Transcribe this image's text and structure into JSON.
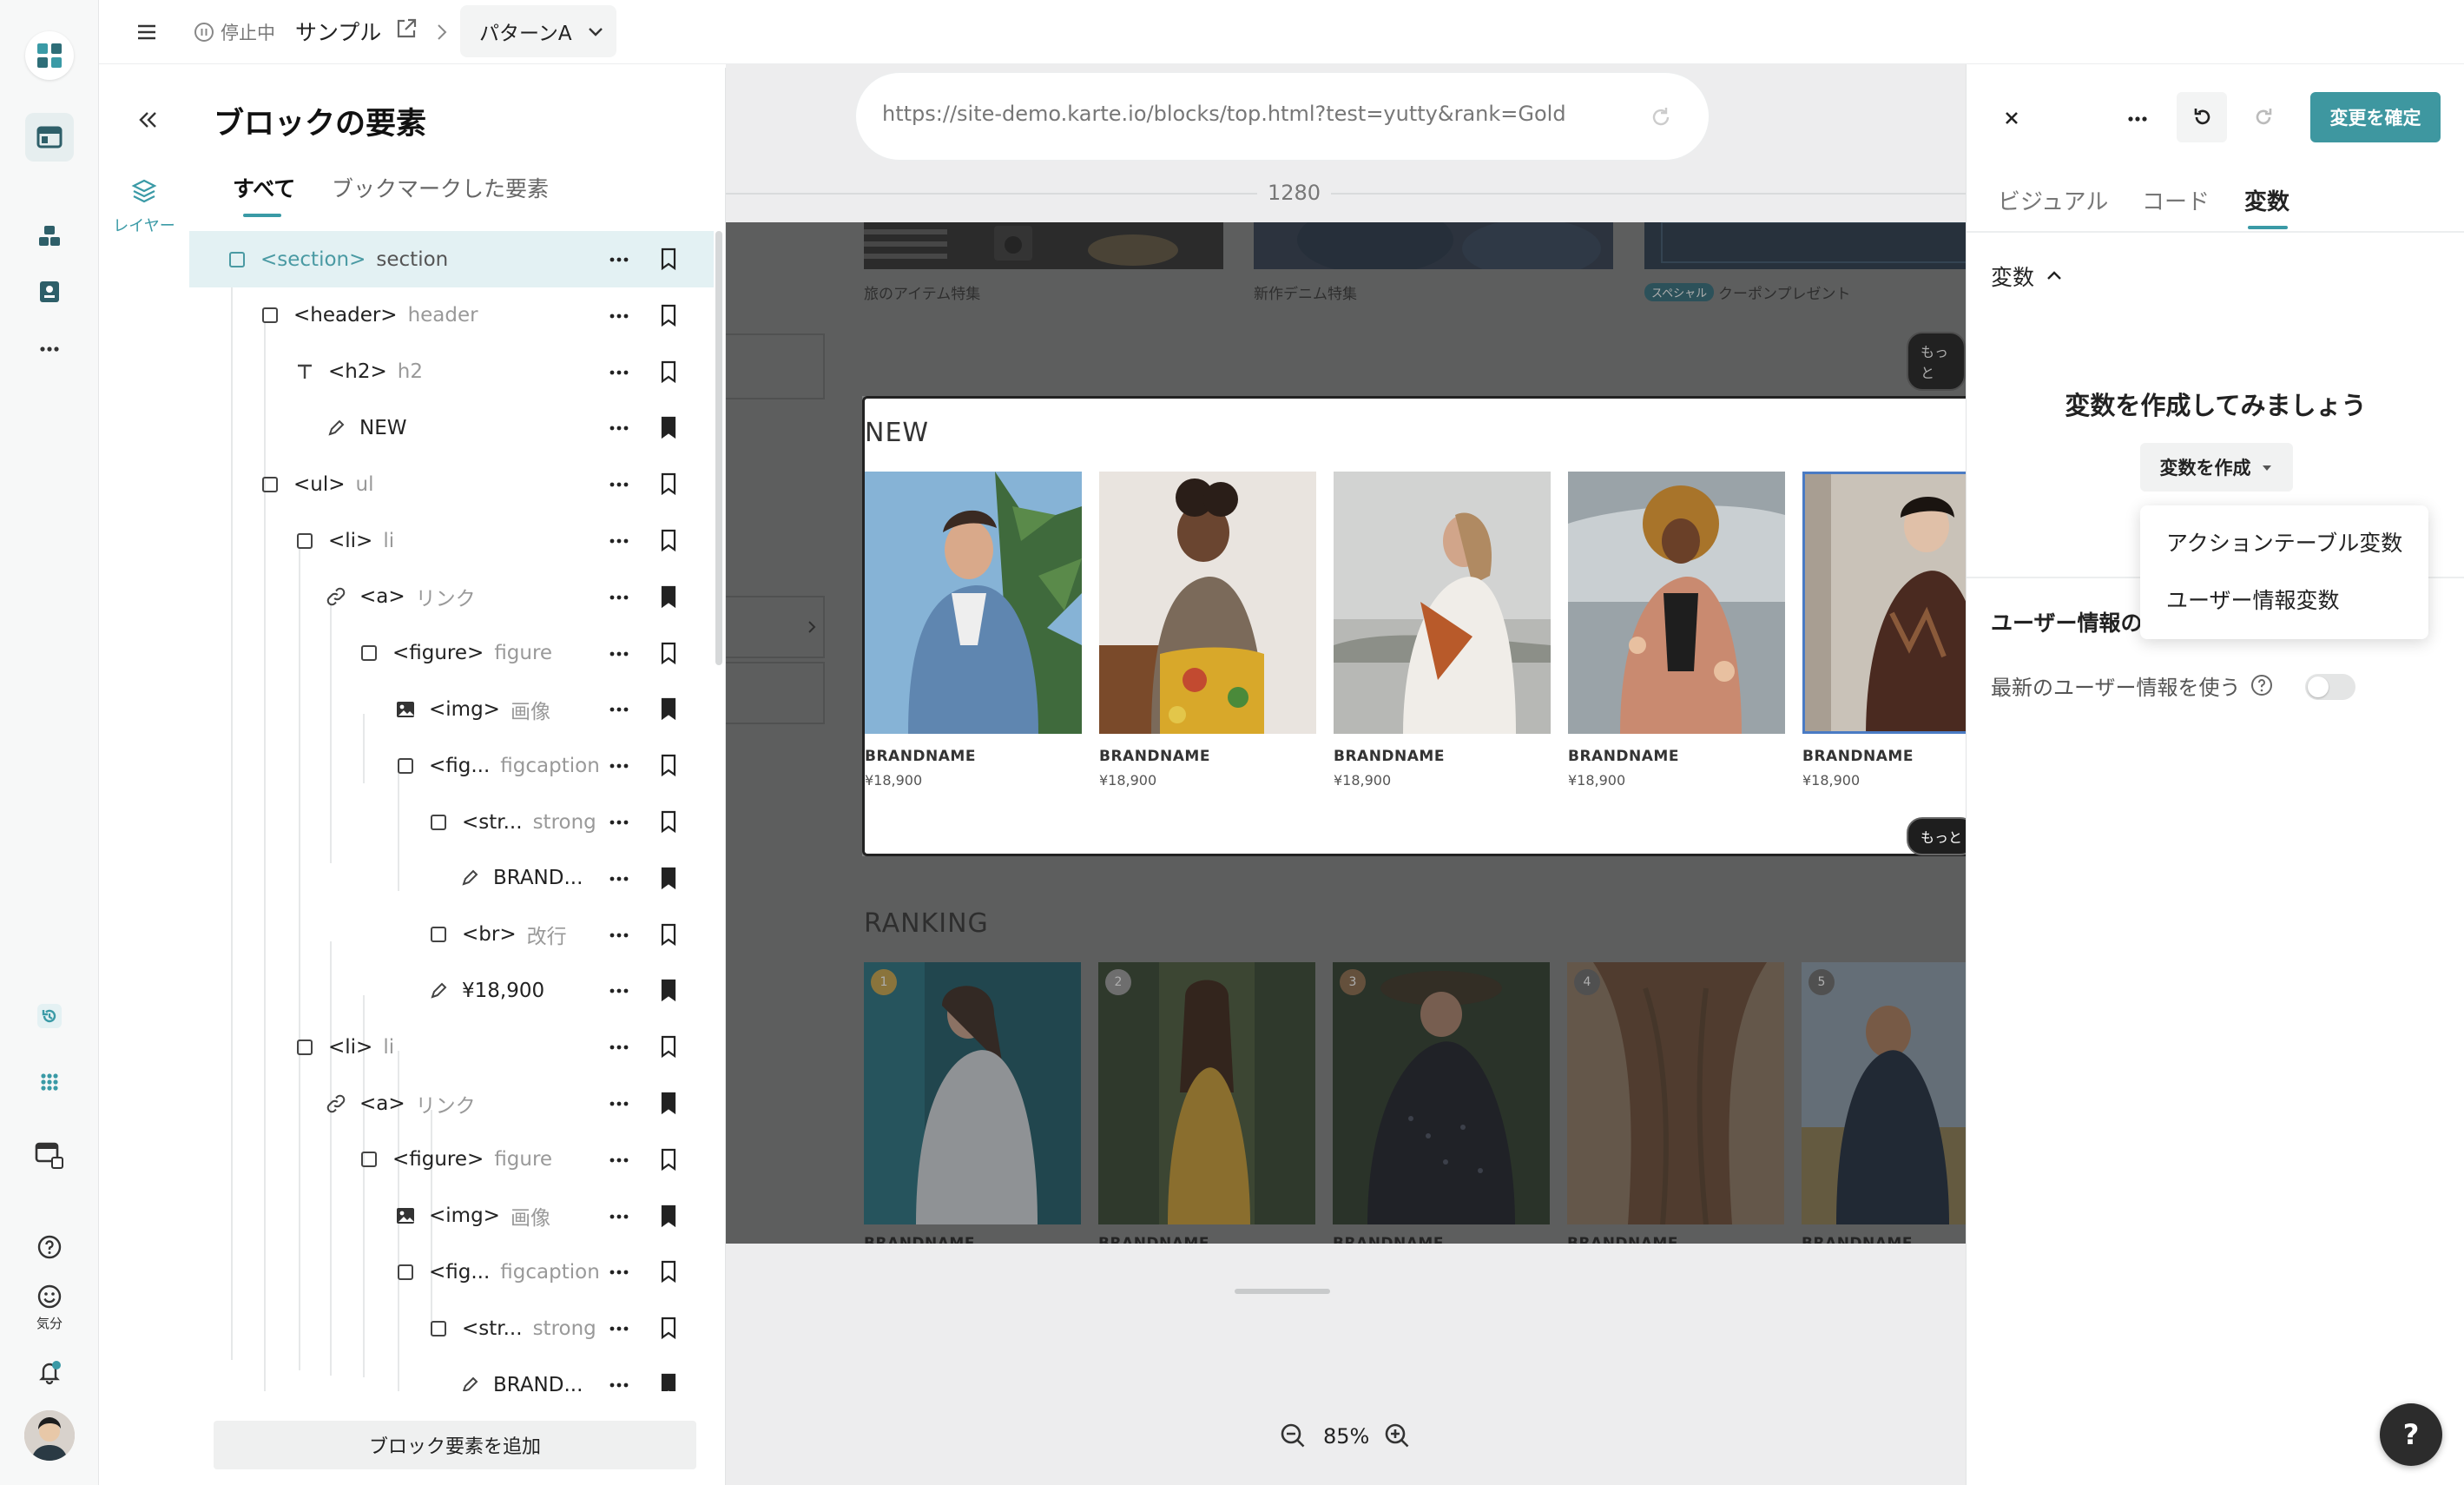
{
  "topbar": {
    "status": "停止中",
    "site": "サンプル",
    "pattern": "パターンA"
  },
  "layers_tab": {
    "label": "レイヤー"
  },
  "panel": {
    "title": "ブロックの要素",
    "tabs": [
      "すべて",
      "ブックマークした要素"
    ],
    "rows": [
      {
        "tag": "<section>",
        "name": "section"
      },
      {
        "tag": "<header>",
        "name": "header"
      },
      {
        "tag": "<h2>",
        "name": "h2"
      },
      {
        "tag": "NEW",
        "name": ""
      },
      {
        "tag": "<ul>",
        "name": "ul"
      },
      {
        "tag": "<li>",
        "name": "li"
      },
      {
        "tag": "<a>",
        "name": "リンク"
      },
      {
        "tag": "<figure>",
        "name": "figure"
      },
      {
        "tag": "<img>",
        "name": "画像"
      },
      {
        "tag": "<fig...",
        "name": "figcaption"
      },
      {
        "tag": "<str...",
        "name": "strong"
      },
      {
        "tag": "BRAND...",
        "name": ""
      },
      {
        "tag": "<br>",
        "name": "改行"
      },
      {
        "tag": "¥18,900",
        "name": ""
      },
      {
        "tag": "<li>",
        "name": "li"
      },
      {
        "tag": "<a>",
        "name": "リンク"
      },
      {
        "tag": "<figure>",
        "name": "figure"
      },
      {
        "tag": "<img>",
        "name": "画像"
      },
      {
        "tag": "<fig...",
        "name": "figcaption"
      },
      {
        "tag": "<str...",
        "name": "strong"
      },
      {
        "tag": "BRAND...",
        "name": ""
      }
    ],
    "add_button": "ブロック要素を追加"
  },
  "canvas": {
    "url": "https://site-demo.karte.io/blocks/top.html?test=yutty&rank=Gold",
    "width_label": "1280",
    "zoom": "85%",
    "features": [
      "旅のアイテム特集",
      "新作デニム特集",
      "クーポンプレゼント"
    ],
    "feature_badge": "スペシャル",
    "more": "もっと",
    "new_title": "NEW",
    "ranking_title": "RANKING",
    "new_items": [
      {
        "brand": "BRANDNAME",
        "price": "¥18,900"
      },
      {
        "brand": "BRANDNAME",
        "price": "¥18,900"
      },
      {
        "brand": "BRANDNAME",
        "price": "¥18,900"
      },
      {
        "brand": "BRANDNAME",
        "price": "¥18,900"
      },
      {
        "brand": "BRANDNAME",
        "price": "¥18,900"
      }
    ],
    "ranks": [
      "1",
      "2",
      "3",
      "4",
      "5"
    ],
    "ranking_brand": "BRANDNAME"
  },
  "right": {
    "confirm": "変更を確定",
    "tabs": [
      "ビジュアル",
      "コード",
      "変数"
    ],
    "section": "変数",
    "empty_title": "変数を作成してみましょう",
    "create_button": "変数を作成",
    "menu": [
      "アクションテーブル変数",
      "ユーザー情報変数"
    ],
    "user_section": "ユーザー情報の",
    "toggle_label": "最新のユーザー情報を使う"
  },
  "rail": {
    "mood_label": "気分"
  },
  "help": "?"
}
